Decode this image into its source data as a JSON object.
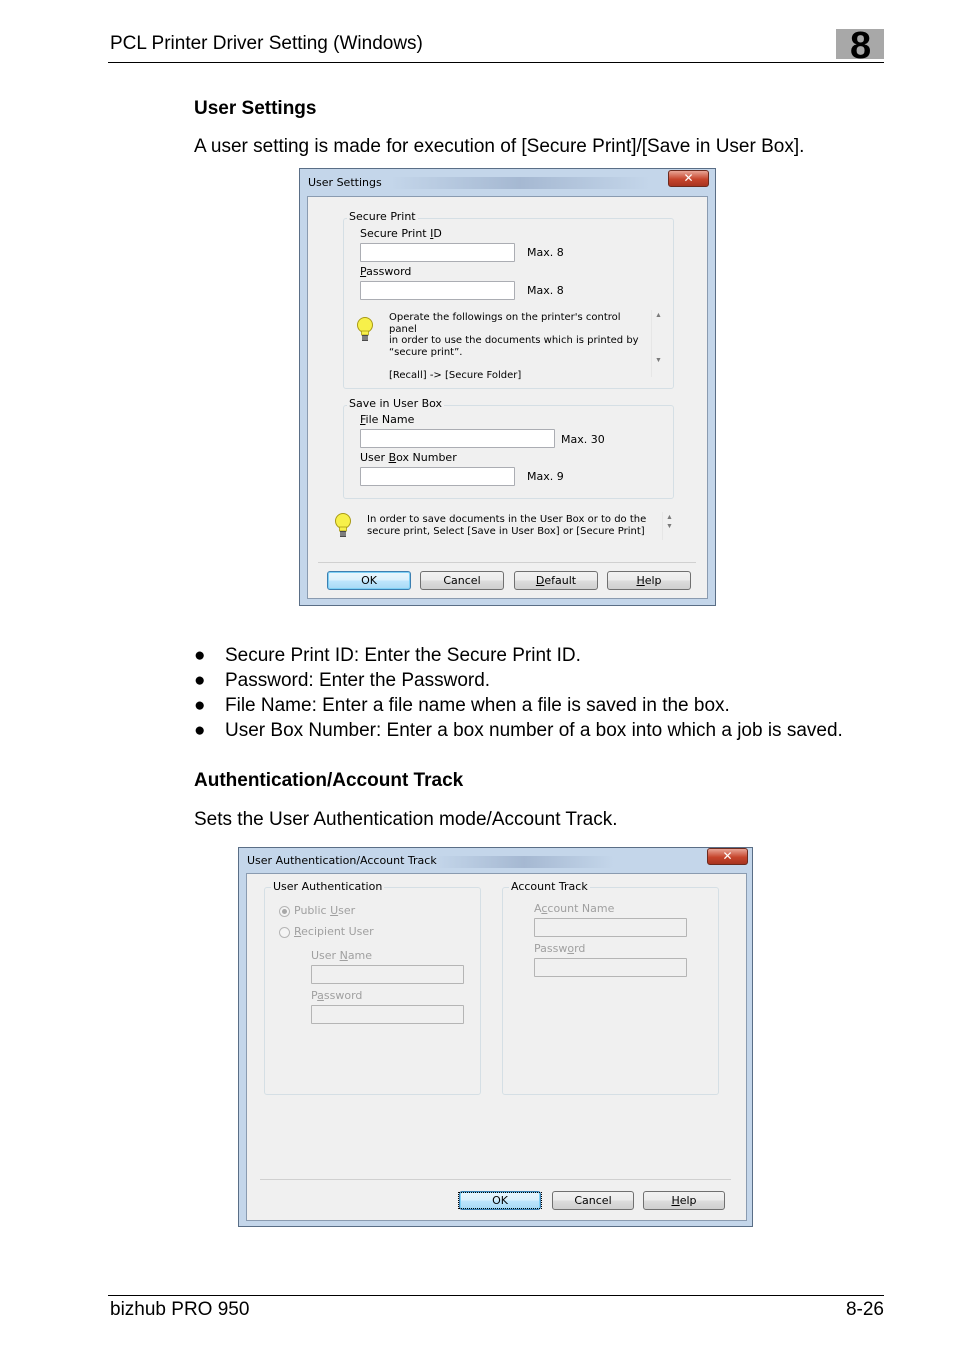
{
  "header": {
    "title": "PCL Printer Driver Setting (Windows)",
    "chapter": "8"
  },
  "section1": {
    "heading": "User Settings",
    "intro": "A user setting is made for execution of [Secure Print]/[Save in User Box]."
  },
  "dialog1": {
    "title": "User Settings",
    "close_icon": "close-icon",
    "secure_print": {
      "group_label": "Secure Print",
      "id_label": "Secure Print ID",
      "id_value": "",
      "id_max": "Max. 8",
      "password_label": "Password",
      "password_value": "",
      "password_max": "Max. 8",
      "tip_icon": "lightbulb-icon",
      "tip_text": "Operate the followings on the printer's control panel\nin order to use the documents which is printed by\n“secure print”.\n\n[Recall] -> [Secure Folder]"
    },
    "save_in_box": {
      "group_label": "Save in User Box",
      "file_label": "File Name",
      "file_value": "",
      "file_max": "Max. 30",
      "box_label": "User Box Number",
      "box_value": "",
      "box_max": "Max. 9"
    },
    "bottom_tip": {
      "icon": "lightbulb-icon",
      "text": "In order to save documents in the User Box or to do the\nsecure print, Select [Save in User Box] or [Secure Print]"
    },
    "buttons": {
      "ok": "OK",
      "cancel": "Cancel",
      "default": "Default",
      "help": "Help"
    }
  },
  "bullets": [
    "Secure Print ID: Enter the Secure Print ID.",
    "Password: Enter the Password.",
    "File Name: Enter a file name when a file is saved in the box.",
    "User Box Number: Enter a box number of a box into which a job is saved."
  ],
  "bullet_glyph": "●",
  "section2": {
    "heading": "Authentication/Account Track",
    "intro": "Sets the User Authentication mode/Account Track."
  },
  "dialog2": {
    "title": "User Authentication/Account Track",
    "user_auth": {
      "group_label": "User Authentication",
      "radio_public": "Public User",
      "radio_recipient": "Recipient User",
      "selected": "Public User",
      "user_name_label": "User Name",
      "user_name_value": "",
      "password_label": "Password",
      "password_value": ""
    },
    "account_track": {
      "group_label": "Account Track",
      "account_name_label": "Account Name",
      "account_name_value": "",
      "password_label": "Password",
      "password_value": ""
    },
    "buttons": {
      "ok": "OK",
      "cancel": "Cancel",
      "help": "Help"
    }
  },
  "footer": {
    "product": "bizhub PRO 950",
    "page": "8-26"
  }
}
